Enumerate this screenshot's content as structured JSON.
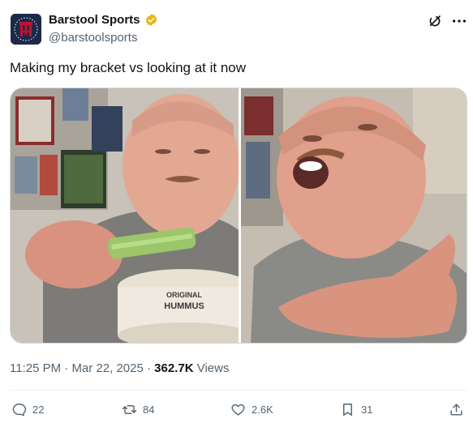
{
  "author": {
    "display_name": "Barstool Sports",
    "handle": "@barstoolsports",
    "verified": true,
    "avatar_icon": "barstool-logo"
  },
  "tweet": {
    "text": "Making my bracket vs looking at it now"
  },
  "media": {
    "panels": [
      {
        "icon": "photo-man-eating-celery-hummus",
        "label_on_tub_line1": "ORIGINAL",
        "label_on_tub_line2": "HUMMUS"
      },
      {
        "icon": "photo-man-gasping"
      }
    ]
  },
  "meta": {
    "time": "11:25 PM",
    "separator": " · ",
    "date": "Mar 22, 2025",
    "views_count": "362.7K",
    "views_label": " Views"
  },
  "actions": {
    "reply_count": "22",
    "retweet_count": "84",
    "like_count": "2.6K",
    "bookmark_count": "31"
  },
  "colors": {
    "text_primary": "#0f1419",
    "text_secondary": "#536471",
    "verified_gold": "#e2b719",
    "avatar_bg": "#1b2a4a",
    "avatar_accent": "#c8102e"
  }
}
